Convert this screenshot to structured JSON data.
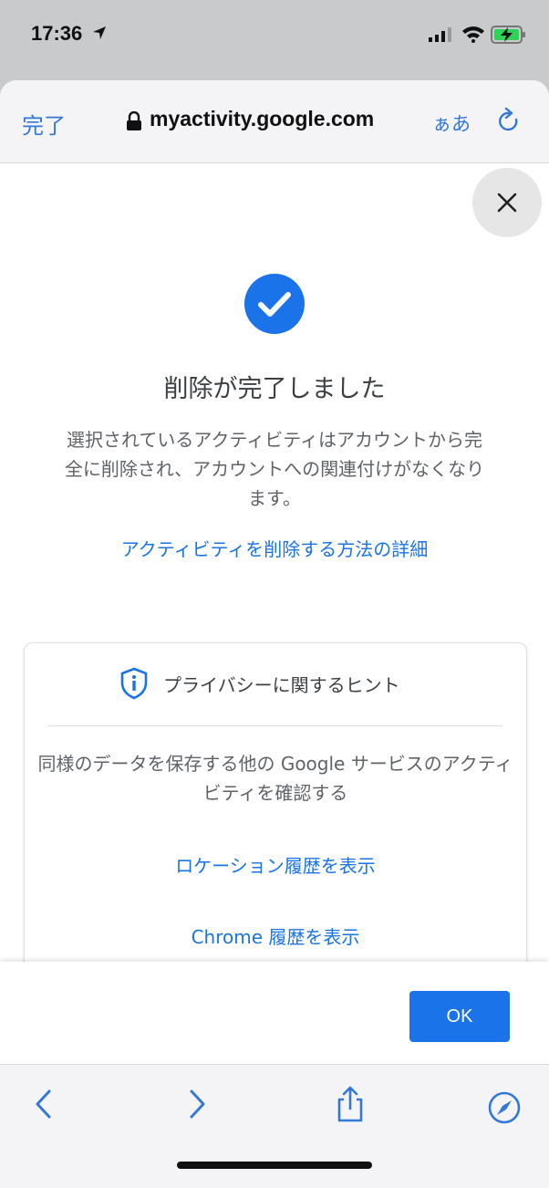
{
  "status_bar": {
    "time": "17:36"
  },
  "browser": {
    "done_label": "完了",
    "url": "myactivity.google.com",
    "text_size_label": "ぁあ"
  },
  "dialog": {
    "title": "削除が完了しました",
    "description": "選択されているアクティビティはアカウントから完全に削除され、アカウントへの関連付けがなくなります。",
    "learn_more_link": "アクティビティを削除する方法の詳細",
    "tips": {
      "title": "プライバシーに関するヒント",
      "description": "同様のデータを保存する他の Google サービスのアクティビティを確認する",
      "location_history_link": "ロケーション履歴を表示",
      "chrome_history_link": "Chrome 履歴を表示"
    },
    "ok_label": "OK"
  },
  "colors": {
    "accent": "#1a73e8",
    "ios_blue": "#3478d6",
    "battery": "#30d158"
  },
  "icons": [
    "location-arrow-icon",
    "signal-icon",
    "wifi-icon",
    "battery-charging-icon",
    "lock-icon",
    "reload-icon",
    "close-icon",
    "check-circle-icon",
    "shield-info-icon",
    "back-icon",
    "forward-icon",
    "share-icon",
    "safari-compass-icon"
  ]
}
